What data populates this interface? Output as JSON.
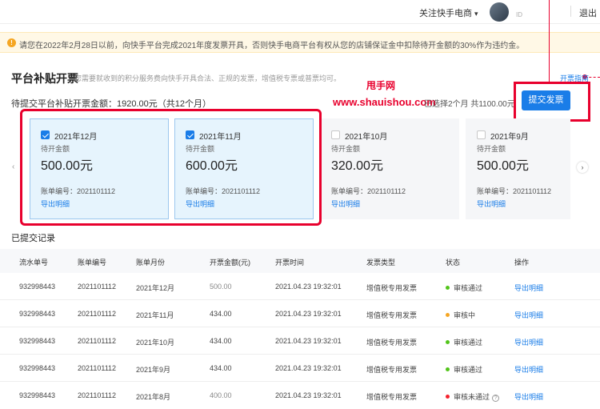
{
  "topbar": {
    "follow_label": "关注快手电商",
    "chevron": "▾",
    "uid_label": "ID",
    "logout_label": "退出"
  },
  "notice": {
    "icon": "!",
    "text": "请您在2022年2月28日以前，向快手平台完成2021年度发票开具，否则快手电商平台有权从您的店铺保证金中扣除待开金额的30%作为违约金。"
  },
  "header": {
    "title": "平台补贴开票",
    "subtitle": "您需要就收到的积分服务费向快手开具合法、正规的发票，增值税专票或普票均可。",
    "guide_link": "开票指南"
  },
  "watermark": {
    "name": "甩手网",
    "url": "www.shauishou.com"
  },
  "summary": {
    "pending_text": "待提交平台补贴开票金额：1920.00元（共12个月）",
    "selected_text": "已选择2个月 共1100.00元",
    "submit_label": "提交发票"
  },
  "nav": {
    "prev": "‹",
    "next": "›"
  },
  "cards": [
    {
      "month": "2021年12月",
      "label": "待开金额",
      "amount": "500.00元",
      "bill": "账单编号：2021101112",
      "export": "导出明细",
      "checked": true
    },
    {
      "month": "2021年11月",
      "label": "待开金额",
      "amount": "600.00元",
      "bill": "账单编号：2021101112",
      "export": "导出明细",
      "checked": true
    },
    {
      "month": "2021年10月",
      "label": "待开金额",
      "amount": "320.00元",
      "bill": "账单编号：2021101112",
      "export": "导出明细",
      "checked": false
    },
    {
      "month": "2021年9月",
      "label": "待开金额",
      "amount": "500.00元",
      "bill": "账单编号：2021101112",
      "export": "导出明细",
      "checked": false
    }
  ],
  "records": {
    "title": "已提交记录",
    "columns": [
      "流水单号",
      "账单编号",
      "账单月份",
      "开票金额(元)",
      "开票时间",
      "发票类型",
      "状态",
      "操作"
    ],
    "rows": [
      {
        "serial": "932998443",
        "bill": "2021101112",
        "month": "2021年12月",
        "amount": "500.00",
        "time": "2021.04.23 19:32:01",
        "type": "增值税专用发票",
        "status": "审核通过",
        "status_color": "#52c41a",
        "action": "导出明细"
      },
      {
        "serial": "932998443",
        "bill": "2021101112",
        "month": "2021年11月",
        "amount": "434.00",
        "time": "2021.04.23 19:32:01",
        "type": "增值税专用发票",
        "status": "审核中",
        "status_color": "#f5a623",
        "action": "导出明细"
      },
      {
        "serial": "932998443",
        "bill": "2021101112",
        "month": "2021年10月",
        "amount": "434.00",
        "time": "2021.04.23 19:32:01",
        "type": "增值税专用发票",
        "status": "审核通过",
        "status_color": "#52c41a",
        "action": "导出明细"
      },
      {
        "serial": "932998443",
        "bill": "2021101112",
        "month": "2021年9月",
        "amount": "434.00",
        "time": "2021.04.23 19:32:01",
        "type": "增值税专用发票",
        "status": "审核通过",
        "status_color": "#52c41a",
        "action": "导出明细"
      },
      {
        "serial": "932998443",
        "bill": "2021101112",
        "month": "2021年8月",
        "amount": "400.00",
        "time": "2021.04.23 19:32:01",
        "type": "增值税专用发票",
        "status": "审核未通过",
        "status_color": "#f5222d",
        "action": "导出明细"
      }
    ]
  },
  "colors": {
    "accent": "#1a7de8",
    "annotation": "#e8002d",
    "warning": "#f5a623"
  }
}
